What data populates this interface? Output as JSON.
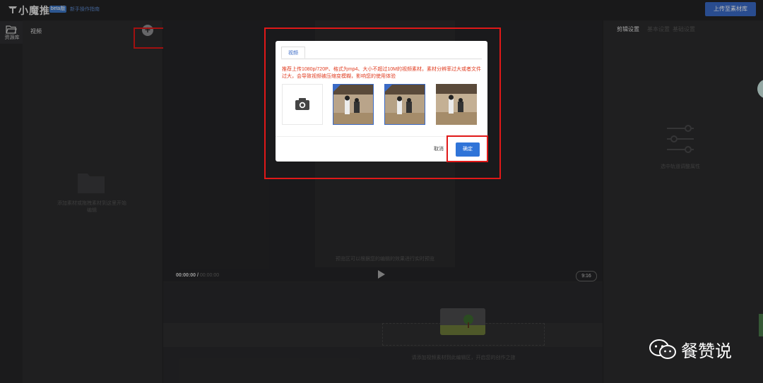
{
  "header": {
    "app_name": "小魔推",
    "beta_badge": "beta版",
    "guide_link": "新手操作指南",
    "upload_button": "上传至素材库"
  },
  "left_rail": {
    "items": [
      {
        "label": "资源库",
        "icon": "folder-open-icon"
      }
    ]
  },
  "library": {
    "tab": "视频",
    "add_icon": "plus-circle-icon",
    "empty_hint": "添加素材或拖拽素材到这里开始编辑"
  },
  "player": {
    "preview_hint": "预览区可以根据您的编辑的效果进行实时预览",
    "time_current": "00:00:00 /",
    "time_total": "00:00:00",
    "ratio": "9:16"
  },
  "timeline": {
    "hint": "请添加视频素材到此编辑区，开启您的创作之旅"
  },
  "right_panel": {
    "tabs": [
      "剪辑设置",
      "基本设置",
      "基础设置"
    ],
    "hint": "选中轨道调整属性"
  },
  "dialog": {
    "tab": "视频",
    "notice": "推荐上传1080p/720P、格式为mp4、大小不超过10M的视频素材。素材分辨率过大或者文件过大，会导致视频被压缩变模糊，影响您的使用体验",
    "camera_icon": "camera-icon",
    "thumbnails": [
      {
        "selected": true
      },
      {
        "selected": true
      },
      {
        "selected": false
      }
    ],
    "cancel": "取消",
    "confirm": "确定"
  },
  "annotation_color": "#e01818",
  "accent": "#3a6ac6",
  "watermark": {
    "text": "餐赞说",
    "icon": "wechat-icon"
  }
}
